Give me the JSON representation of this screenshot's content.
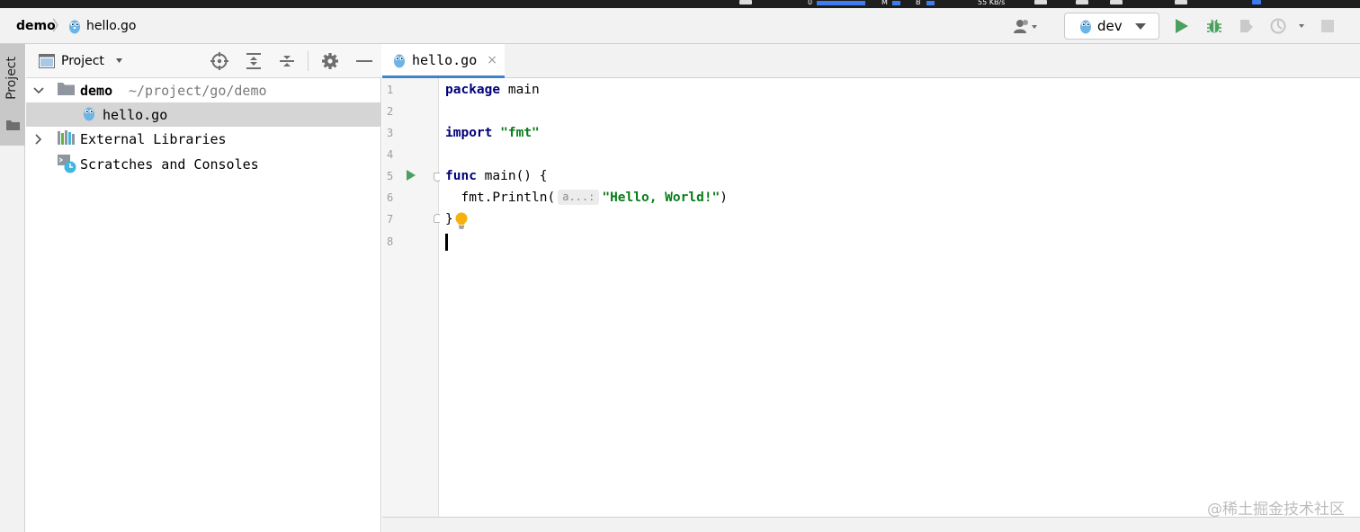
{
  "menubar": {
    "net_speed": "55 KB/s",
    "m_label": "M",
    "b_label": "B",
    "cpu_label": "0"
  },
  "navbar": {
    "breadcrumb_root": "demo",
    "breadcrumb_sep": "〉",
    "breadcrumb_file": "hello.go",
    "run_config": "dev"
  },
  "tool_strip": {
    "project_label": "Project"
  },
  "project_panel": {
    "title": "Project",
    "tree": {
      "root_name": "demo",
      "root_path": "~/project/go/demo",
      "file_name": "hello.go",
      "external_libraries": "External Libraries",
      "scratches": "Scratches and Consoles"
    }
  },
  "editor": {
    "tab_label": "hello.go",
    "tab_close": "×",
    "line_numbers": [
      "1",
      "2",
      "3",
      "4",
      "5",
      "6",
      "7",
      "8"
    ],
    "code": {
      "l1_kw": "package",
      "l1_rest": " main",
      "l3_kw": "import",
      "l3_str": "\"fmt\"",
      "l5_kw": "func",
      "l5_rest": " main() {",
      "l6_pre": "  fmt.Println(",
      "l6_hint": "a...:",
      "l6_str": "\"Hello, World!\"",
      "l6_post": ")",
      "l7": "}"
    }
  },
  "watermark": "@稀土掘金技术社区",
  "colors": {
    "keyword": "#00007a",
    "string": "#077d17",
    "run_green": "#4ba05e",
    "tab_underline": "#4083c9"
  }
}
